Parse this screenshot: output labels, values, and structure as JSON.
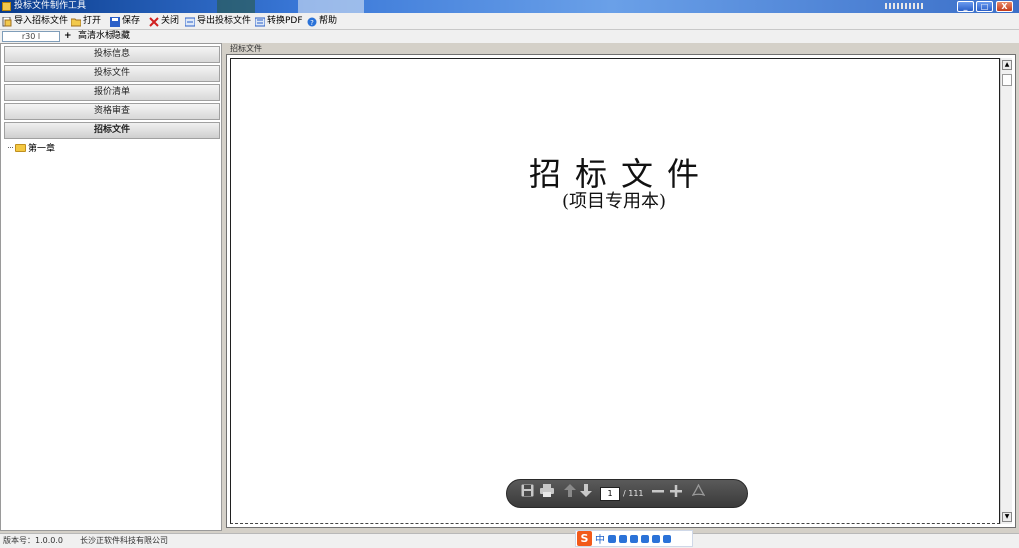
{
  "window": {
    "title": "投标文件制作工具",
    "controls": {
      "minimize": "_",
      "maximize": "□",
      "close": "X"
    }
  },
  "toolbar": {
    "import_label": "导入招标文件",
    "open_label": "打开",
    "save_label": "保存",
    "close_label": "关闭",
    "export_label": "导出投标文件",
    "pdf_label": "转换PDF",
    "help_label": "帮助"
  },
  "options": {
    "combo_value": "r30 l",
    "plus": "+",
    "item1": "高清水标",
    "item2": "隐藏"
  },
  "sidebar": {
    "items": [
      {
        "label": "投标信息"
      },
      {
        "label": "投标文件"
      },
      {
        "label": "报价清单"
      },
      {
        "label": "资格审查"
      },
      {
        "label": "招标文件"
      }
    ],
    "tree_root": "第一章"
  },
  "document": {
    "caption": "招标文件",
    "title": "招标文件",
    "subtitle": "(项目专用本)",
    "page_current": "1",
    "page_total": "/ 111"
  },
  "statusbar": {
    "version": "版本号：1.0.0.0",
    "company": "长沙正软件科技有限公司"
  },
  "ime": {
    "logo": "S",
    "mode": "中"
  },
  "colors": {
    "titlebar": "#3a78d8",
    "window_bg": "#d4d0c8",
    "pdf_toolbar": "#4a4a4a",
    "ime_logo": "#f25a1a"
  }
}
